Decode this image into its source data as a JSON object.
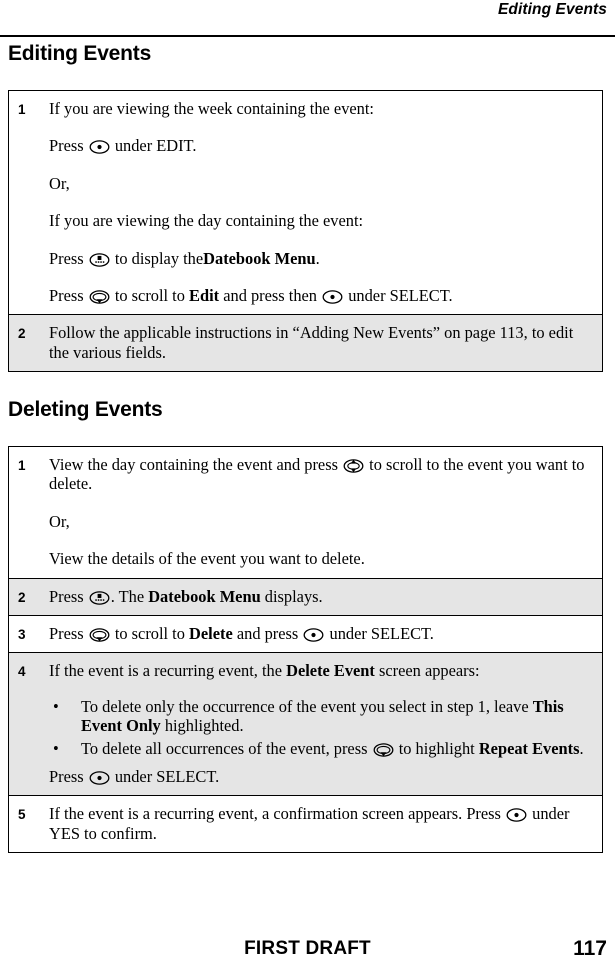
{
  "header": {
    "running_title": "Editing Events"
  },
  "sections": [
    {
      "heading": "Editing Events",
      "steps": [
        {
          "number": "1",
          "shaded": false,
          "paragraphs": [
            "If you are viewing the week containing the event:",
            "Press [select-key] under EDIT.",
            "Or,",
            "If you are viewing the day containing the event:",
            "Press [menu-key] to display the Datebook Menu.",
            "Press [scroll-down-key] to scroll to Edit and press then [select-key] under SELECT."
          ]
        },
        {
          "number": "2",
          "shaded": true,
          "paragraphs": [
            "Follow the applicable instructions in “Adding New Events” on page 113, to edit the various fields."
          ]
        }
      ]
    },
    {
      "heading": "Deleting Events",
      "steps": [
        {
          "number": "1",
          "shaded": false,
          "paragraphs": [
            "View the day containing the event and press [scroll-key] to scroll to the event you want to delete.",
            "Or,",
            "View the details of the event you want to delete."
          ]
        },
        {
          "number": "2",
          "shaded": true,
          "paragraphs": [
            "Press [menu-key]. The Datebook Menu displays."
          ]
        },
        {
          "number": "3",
          "shaded": false,
          "paragraphs": [
            "Press [scroll-down-key] to scroll to Delete and press [select-key] under SELECT."
          ]
        },
        {
          "number": "4",
          "shaded": true,
          "paragraphs": [
            "If the event is a recurring event, the Delete Event screen appears:"
          ],
          "bullets": [
            "To delete only the occurrence of the event you select in step 1, leave This Event Only highlighted.",
            "To delete all occurrences of the event, press [scroll-down-key] to highlight Repeat Events."
          ],
          "after_bullets": "Press [select-key] under SELECT."
        },
        {
          "number": "5",
          "shaded": false,
          "paragraphs": [
            "If the event is a recurring event, a confirmation screen appears. Press [select-key] under YES to confirm."
          ]
        }
      ]
    }
  ],
  "text_fragments": {
    "s1_p1": "If you are viewing the week containing the event:",
    "s1_p2_a": "Press",
    "s1_p2_b": "under EDIT.",
    "s1_p3": "Or,",
    "s1_p4": "If you are viewing the day containing the event:",
    "s1_p5_a": "Press",
    "s1_p5_b": "to display the",
    "s1_p5_bold": "Datebook Menu",
    "s1_p5_c": ".",
    "s1_p6_a": "Press",
    "s1_p6_b": "to scroll to",
    "s1_p6_bold": "Edit",
    "s1_p6_c": "and press then",
    "s1_p6_d": "under SELECT.",
    "s2_p1": "Follow the applicable instructions in “Adding New Events” on page 113, to edit the various fields.",
    "d1_p1_a": "View the day containing the event and press",
    "d1_p1_b": "to scroll to the event you want to delete.",
    "d1_p2": "Or,",
    "d1_p3": "View the details of the event you want to delete.",
    "d2_p1_a": "Press",
    "d2_p1_b": ". The",
    "d2_p1_bold": "Datebook Menu",
    "d2_p1_c": "displays.",
    "d3_p1_a": "Press",
    "d3_p1_b": "to scroll to",
    "d3_p1_bold": "Delete",
    "d3_p1_c": "and press",
    "d3_p1_d": "under SELECT.",
    "d4_p1_a": "If the event is a recurring event, the",
    "d4_p1_bold": "Delete Event",
    "d4_p1_b": "screen appears:",
    "d4_b1_a": "To delete only the occurrence of the event you select in step 1, leave",
    "d4_b1_bold": "This Event Only",
    "d4_b1_b": "highlighted.",
    "d4_b2_a": "To delete all occurrences of the event, press",
    "d4_b2_b": "to highlight",
    "d4_b2_bold": "Repeat Events",
    "d4_b2_c": ".",
    "d4_after_a": "Press",
    "d4_after_b": "under SELECT.",
    "d5_p1_a": "If the event is a recurring event, a confirmation screen appears. Press",
    "d5_p1_b": "under YES to confirm.",
    "bullet_char": "•"
  },
  "footer": {
    "draft_label": "FIRST DRAFT",
    "page_number": "117"
  },
  "colors": {
    "text": "#000000",
    "page_background": "#ffffff",
    "shaded_row": "#e5e5e5",
    "rule": "#000000"
  },
  "icons": {
    "select_key": "select-key-icon",
    "menu_key": "menu-key-icon",
    "scroll_down_key": "scroll-down-key-icon",
    "scroll_key": "scroll-up-down-key-icon"
  }
}
